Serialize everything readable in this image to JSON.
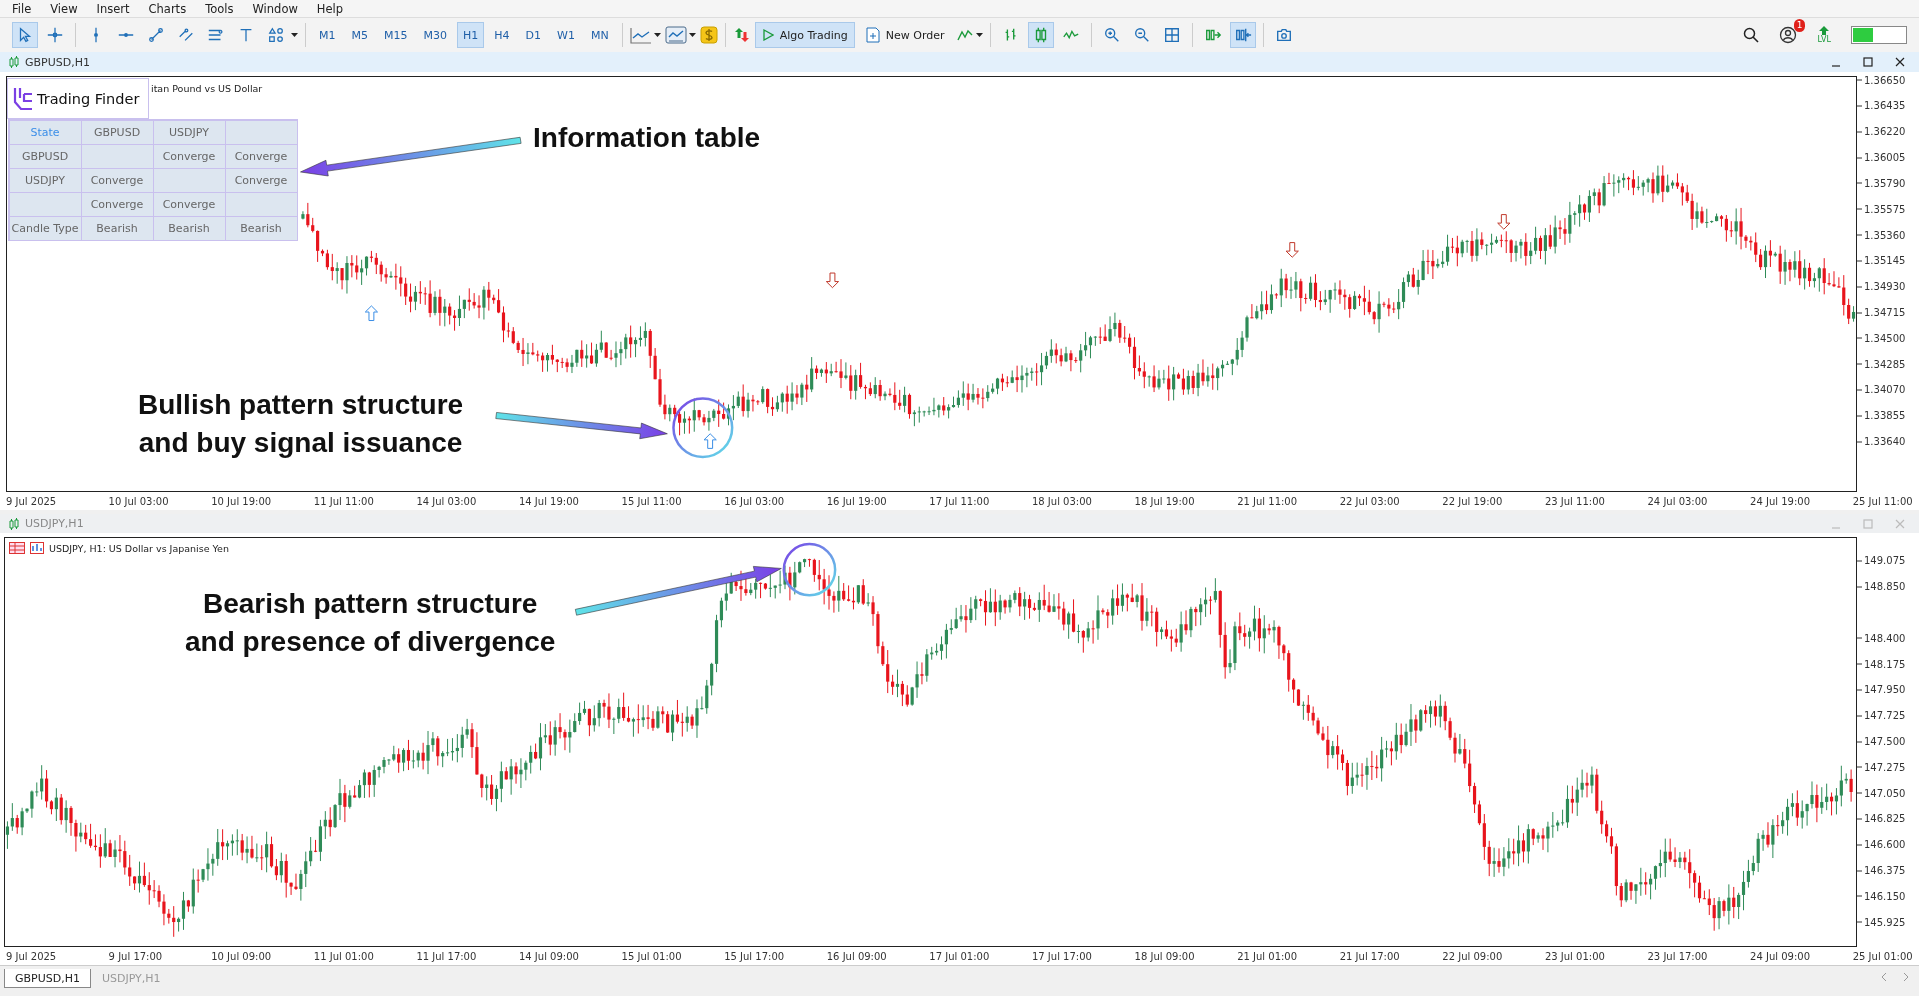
{
  "menu": [
    "File",
    "View",
    "Insert",
    "Charts",
    "Tools",
    "Window",
    "Help"
  ],
  "toolbar": {
    "drawing_tools": [
      {
        "selected": true
      },
      {
        "selected": false
      },
      {
        "selected": false
      },
      {
        "selected": false
      },
      {
        "selected": false
      },
      {
        "selected": false
      },
      {
        "selected": false
      },
      {
        "selected": false
      },
      {
        "selected": false
      }
    ],
    "timeframes": [
      {
        "label": "M1",
        "selected": false
      },
      {
        "label": "M5",
        "selected": false
      },
      {
        "label": "M15",
        "selected": false
      },
      {
        "label": "M30",
        "selected": false
      },
      {
        "label": "H1",
        "selected": true
      },
      {
        "label": "H4",
        "selected": false
      },
      {
        "label": "D1",
        "selected": false
      },
      {
        "label": "W1",
        "selected": false
      },
      {
        "label": "MN",
        "selected": false
      }
    ],
    "algo_trading": {
      "label": "Algo Trading",
      "on": true
    },
    "new_order": "New Order",
    "chart_tools": [
      {
        "selected": false
      },
      {
        "selected": true
      },
      {
        "selected": false
      },
      {
        "selected": false
      },
      {
        "selected": false
      },
      {
        "selected": false
      },
      {
        "selected": false
      },
      {
        "selected": true
      },
      {
        "selected": false
      }
    ],
    "notification_count": "1",
    "level_label": "LVL"
  },
  "charts": [
    {
      "title": "GBPUSD,H1",
      "active": true,
      "legend": "itan Pound vs US Dollar",
      "logo_text": "Trading Finder",
      "info_table": [
        {
          "kind": "header",
          "col_1": "State",
          "col_2": "GBPUSD",
          "col_3": "USDJPY"
        },
        {
          "kind": "body",
          "col_1": "GBPUSD",
          "col_3": "Converge",
          "col_4": "Converge"
        },
        {
          "kind": "body",
          "col_1": "USDJPY",
          "col_2": "Converge",
          "col_4": "Converge"
        },
        {
          "kind": "body",
          "col_2": "Converge",
          "col_3": "Converge"
        },
        {
          "kind": "body",
          "col_1": "Candle Type",
          "col_2": "Bearish",
          "col_3": "Bearish",
          "col_4": "Bearish"
        }
      ],
      "annotations": [
        {
          "lines": [
            "Information table"
          ]
        },
        {
          "lines": [
            "Bullish pattern structure",
            "and buy signal issuance"
          ]
        }
      ],
      "price_axis": [
        "1.36650",
        "1.36435",
        "1.36220",
        "1.36005",
        "1.35790",
        "1.35575",
        "1.35360",
        "1.35145",
        "1.34930",
        "1.34715",
        "1.34500",
        "1.34285",
        "1.34070",
        "1.33855",
        "1.33640"
      ],
      "time_axis": [
        "9 Jul 2025",
        "10 Jul 03:00",
        "10 Jul 19:00",
        "11 Jul 11:00",
        "14 Jul 03:00",
        "14 Jul 19:00",
        "15 Jul 11:00",
        "16 Jul 03:00",
        "16 Jul 19:00",
        "17 Jul 11:00",
        "18 Jul 03:00",
        "18 Jul 19:00",
        "21 Jul 11:00",
        "22 Jul 03:00",
        "22 Jul 19:00",
        "23 Jul 11:00",
        "24 Jul 03:00",
        "24 Jul 19:00",
        "25 Jul 11:00"
      ]
    },
    {
      "title": "USDJPY,H1",
      "active": false,
      "legend": "USDJPY, H1:  US Dollar vs Japanise Yen",
      "annotations": [
        {
          "lines": [
            "Bearish pattern structure",
            "and presence of divergence"
          ]
        }
      ],
      "price_axis": [
        "149.075",
        "148.850",
        "148.400",
        "148.175",
        "147.950",
        "147.725",
        "147.500",
        "147.275",
        "147.050",
        "146.825",
        "146.600",
        "146.375",
        "146.150",
        "145.925"
      ],
      "time_axis": [
        "9 Jul 2025",
        "9 Jul 17:00",
        "10 Jul 09:00",
        "11 Jul 01:00",
        "11 Jul 17:00",
        "14 Jul 09:00",
        "15 Jul 01:00",
        "15 Jul 17:00",
        "16 Jul 09:00",
        "17 Jul 01:00",
        "17 Jul 17:00",
        "18 Jul 09:00",
        "21 Jul 01:00",
        "21 Jul 17:00",
        "22 Jul 09:00",
        "23 Jul 01:00",
        "23 Jul 17:00",
        "24 Jul 09:00",
        "25 Jul 01:00"
      ]
    }
  ],
  "tabs": [
    {
      "label": "GBPUSD,H1",
      "selected": true
    },
    {
      "label": "USDJPY,H1",
      "selected": false
    }
  ]
}
